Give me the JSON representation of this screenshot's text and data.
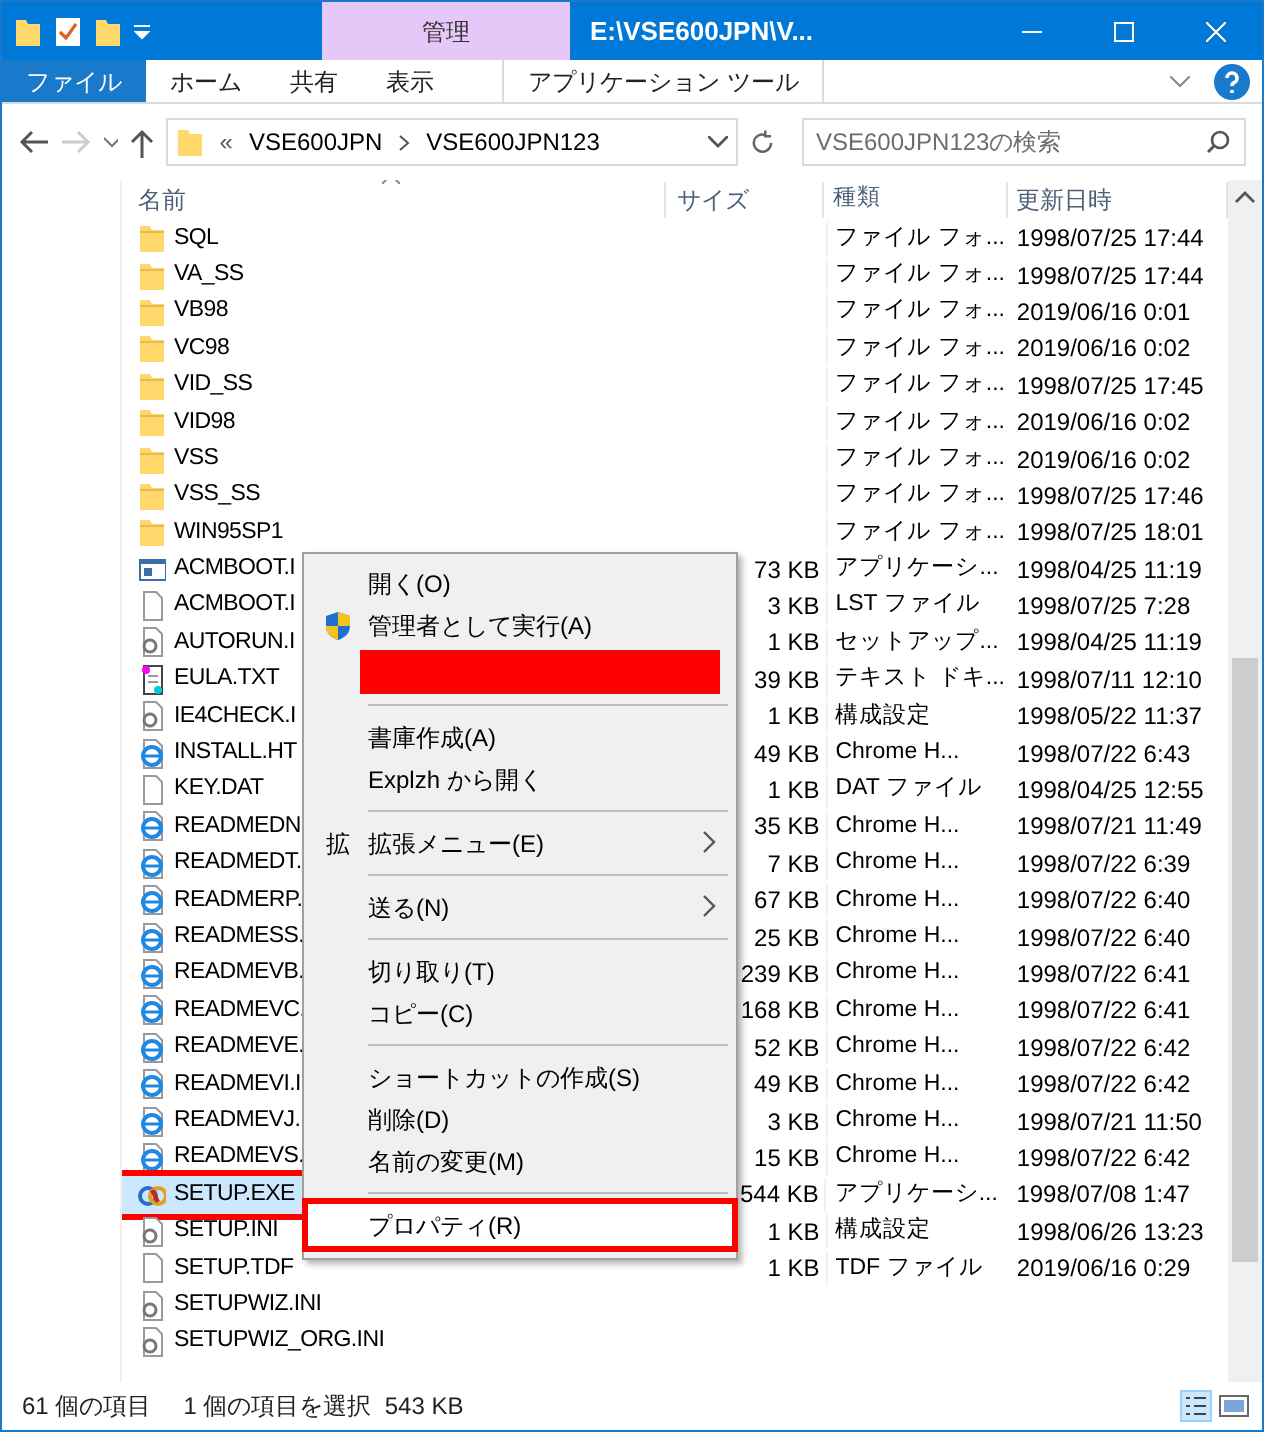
{
  "window": {
    "title": "E:\\VSE600JPN\\V...",
    "context_tab": "管理"
  },
  "ribbon_tabs": [
    {
      "label": "ファイル",
      "selected": true
    },
    {
      "label": "ホーム",
      "selected": false
    },
    {
      "label": "共有",
      "selected": false
    },
    {
      "label": "表示",
      "selected": false
    },
    {
      "label": "アプリケーション ツール",
      "selected": false
    }
  ],
  "address": {
    "overflow": "«",
    "path": [
      "VSE600JPN",
      "VSE600JPN123"
    ]
  },
  "search": {
    "placeholder": "VSE600JPN123の検索"
  },
  "columns": [
    "名前",
    "サイズ",
    "種類",
    "更新日時"
  ],
  "rows": [
    {
      "name": "SQL",
      "kind": "folder",
      "type": "ファイル フォ...",
      "modified": "1998/07/25 17:44",
      "selected": false
    },
    {
      "name": "VA_SS",
      "kind": "folder",
      "type": "ファイル フォ...",
      "modified": "1998/07/25 17:44",
      "selected": false
    },
    {
      "name": "VB98",
      "kind": "folder",
      "type": "ファイル フォ...",
      "modified": "2019/06/16 0:01",
      "selected": false
    },
    {
      "name": "VC98",
      "kind": "folder",
      "type": "ファイル フォ...",
      "modified": "2019/06/16 0:02",
      "selected": false
    },
    {
      "name": "VID_SS",
      "kind": "folder",
      "type": "ファイル フォ...",
      "modified": "1998/07/25 17:45",
      "selected": false
    },
    {
      "name": "VID98",
      "kind": "folder",
      "type": "ファイル フォ...",
      "modified": "2019/06/16 0:02",
      "selected": false
    },
    {
      "name": "VSS",
      "kind": "folder",
      "type": "ファイル フォ...",
      "modified": "2019/06/16 0:02",
      "selected": false
    },
    {
      "name": "VSS_SS",
      "kind": "folder",
      "type": "ファイル フォ...",
      "modified": "1998/07/25 17:46",
      "selected": false
    },
    {
      "name": "WIN95SP1",
      "kind": "folder",
      "type": "ファイル フォ...",
      "modified": "1998/07/25 18:01",
      "selected": false
    },
    {
      "name": "ACMBOOT.I",
      "kind": "app",
      "size": "73 KB",
      "type": "アプリケーシ...",
      "modified": "1998/04/25 11:19",
      "selected": false
    },
    {
      "name": "ACMBOOT.I",
      "kind": "file",
      "size": "3 KB",
      "type": "LST ファイル",
      "modified": "1998/07/25 7:28",
      "selected": false
    },
    {
      "name": "AUTORUN.I",
      "kind": "settings",
      "size": "1 KB",
      "type": "セットアップ...",
      "modified": "1998/04/25 11:19",
      "selected": false
    },
    {
      "name": "EULA.TXT",
      "kind": "text",
      "size": "39 KB",
      "type": "テキスト ドキ...",
      "modified": "1998/07/11 12:10",
      "selected": false
    },
    {
      "name": "IE4CHECK.I",
      "kind": "settings",
      "size": "1 KB",
      "type": "構成設定",
      "modified": "1998/05/22 11:37",
      "selected": false
    },
    {
      "name": "INSTALL.HT",
      "kind": "web",
      "size": "49 KB",
      "type": "Chrome H...",
      "modified": "1998/07/22 6:43",
      "selected": false
    },
    {
      "name": "KEY.DAT",
      "kind": "file",
      "size": "1 KB",
      "type": "DAT ファイル",
      "modified": "1998/04/25 12:55",
      "selected": false
    },
    {
      "name": "READMEDN",
      "kind": "web",
      "size": "35 KB",
      "type": "Chrome H...",
      "modified": "1998/07/21 11:49",
      "selected": false
    },
    {
      "name": "READMEDT.",
      "kind": "web",
      "size": "7 KB",
      "type": "Chrome H...",
      "modified": "1998/07/22 6:39",
      "selected": false
    },
    {
      "name": "READMERP.",
      "kind": "web",
      "size": "67 KB",
      "type": "Chrome H...",
      "modified": "1998/07/22 6:40",
      "selected": false
    },
    {
      "name": "READMESS.",
      "kind": "web",
      "size": "25 KB",
      "type": "Chrome H...",
      "modified": "1998/07/22 6:40",
      "selected": false
    },
    {
      "name": "READMEVB.",
      "kind": "web",
      "size": "239 KB",
      "type": "Chrome H...",
      "modified": "1998/07/22 6:41",
      "selected": false
    },
    {
      "name": "READMEVC.",
      "kind": "web",
      "size": "168 KB",
      "type": "Chrome H...",
      "modified": "1998/07/22 6:41",
      "selected": false
    },
    {
      "name": "READMEVE.",
      "kind": "web",
      "size": "52 KB",
      "type": "Chrome H...",
      "modified": "1998/07/22 6:42",
      "selected": false
    },
    {
      "name": "READMEVI.I",
      "kind": "web",
      "size": "49 KB",
      "type": "Chrome H...",
      "modified": "1998/07/22 6:42",
      "selected": false
    },
    {
      "name": "READMEVJ.",
      "kind": "web",
      "size": "3 KB",
      "type": "Chrome H...",
      "modified": "1998/07/21 11:50",
      "selected": false
    },
    {
      "name": "READMEVS.",
      "kind": "web",
      "size": "15 KB",
      "type": "Chrome H...",
      "modified": "1998/07/22 6:42",
      "selected": false
    },
    {
      "name": "SETUP.EXE",
      "kind": "setup",
      "size": "544 KB",
      "type": "アプリケーシ...",
      "modified": "1998/07/08 1:47",
      "selected": true,
      "highlighted": true
    },
    {
      "name": "SETUP.INI",
      "kind": "settings",
      "size": "1 KB",
      "type": "構成設定",
      "modified": "1998/06/26 13:23",
      "selected": false
    },
    {
      "name": "SETUP.TDF",
      "kind": "file",
      "size": "1 KB",
      "type": "TDF ファイル",
      "modified": "2019/06/16 0:29",
      "selected": false
    },
    {
      "name": "SETUPWIZ.INI",
      "kind": "settings",
      "selected": false
    },
    {
      "name": "SETUPWIZ_ORG.INI",
      "kind": "settings",
      "selected": false
    }
  ],
  "context_menu": {
    "items": [
      {
        "kind": "item",
        "label": "開く(O)"
      },
      {
        "kind": "elevated",
        "label": "管理者として実行(A)"
      },
      {
        "kind": "redacted"
      },
      {
        "kind": "separator"
      },
      {
        "kind": "item",
        "label": "書庫作成(A)"
      },
      {
        "kind": "item",
        "label": "Explzh から開く"
      },
      {
        "kind": "separator"
      },
      {
        "kind": "item",
        "label": "拡張メニュー(E)",
        "glyph": "拡",
        "submenu": true
      },
      {
        "kind": "separator"
      },
      {
        "kind": "item",
        "label": "送る(N)",
        "submenu": true
      },
      {
        "kind": "separator"
      },
      {
        "kind": "item",
        "label": "切り取り(T)"
      },
      {
        "kind": "item",
        "label": "コピー(C)"
      },
      {
        "kind": "separator"
      },
      {
        "kind": "item",
        "label": "ショートカットの作成(S)"
      },
      {
        "kind": "item",
        "label": "削除(D)"
      },
      {
        "kind": "item",
        "label": "名前の変更(M)"
      },
      {
        "kind": "separator"
      },
      {
        "kind": "item",
        "label": "プロパティ(R)",
        "highlighted": true
      }
    ]
  },
  "status_bar": {
    "count": "61 個の項目",
    "selection": "1 個の項目を選択  543 KB"
  }
}
